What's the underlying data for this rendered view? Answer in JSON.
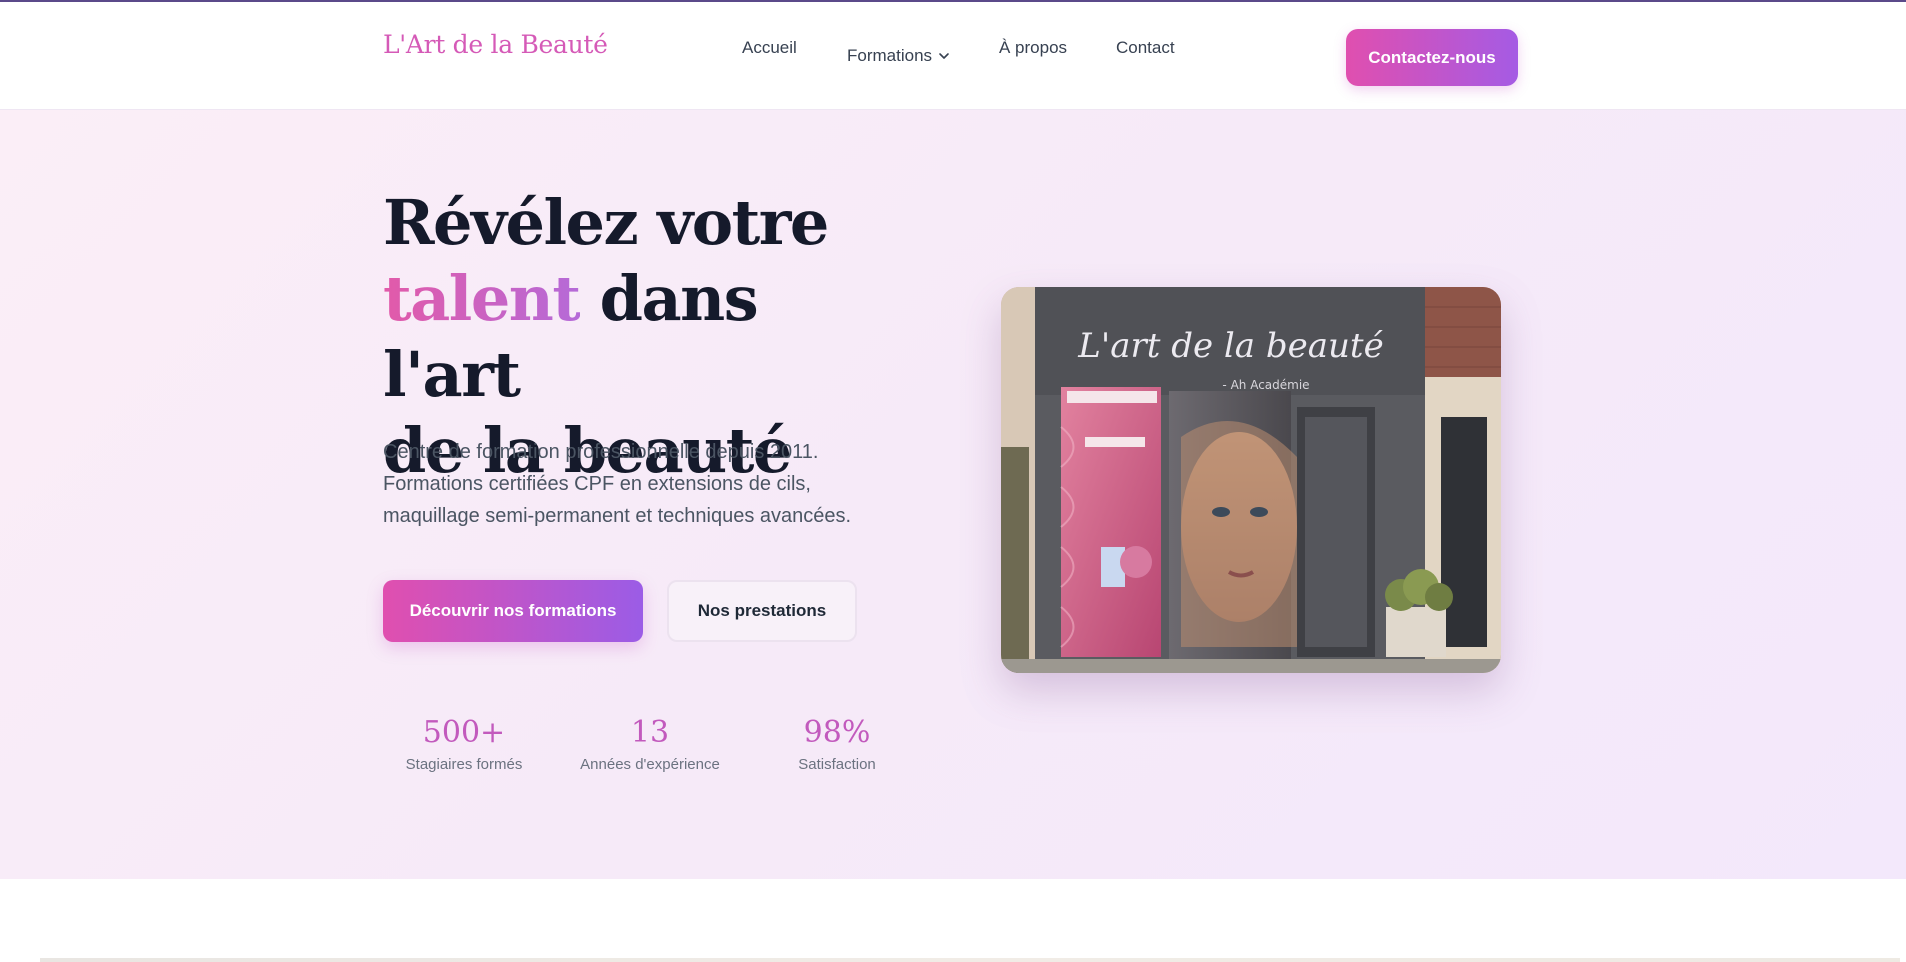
{
  "header": {
    "brand": "L'Art de la Beauté",
    "nav": {
      "accueil": "Accueil",
      "formations": "Formations",
      "apropos": "À propos",
      "contact": "Contact"
    },
    "cta": "Contactez-nous"
  },
  "hero": {
    "title_line1": "Révélez votre",
    "title_accent": "talent",
    "title_line2_rest": " dans l'art",
    "title_line3": "de la beauté",
    "description": "Centre de formation professionnelle depuis 2011. Formations certifiées CPF en extensions de cils, maquillage semi-permanent et techniques avancées.",
    "primary_button": "Découvrir nos formations",
    "secondary_button": "Nos prestations",
    "stats": [
      {
        "value": "500+",
        "label": "Stagiaires formés"
      },
      {
        "value": "13",
        "label": "Années d'expérience"
      },
      {
        "value": "98%",
        "label": "Satisfaction"
      }
    ],
    "image": {
      "sign_text": "L'art de la beauté",
      "sign_subtext": "- Ah Académie"
    }
  },
  "colors": {
    "brand": "#d55ab7",
    "gradient_start": "#e04faf",
    "gradient_end": "#9b5ce6",
    "hero_background": "#f6eaf8",
    "title": "#151a2b"
  }
}
